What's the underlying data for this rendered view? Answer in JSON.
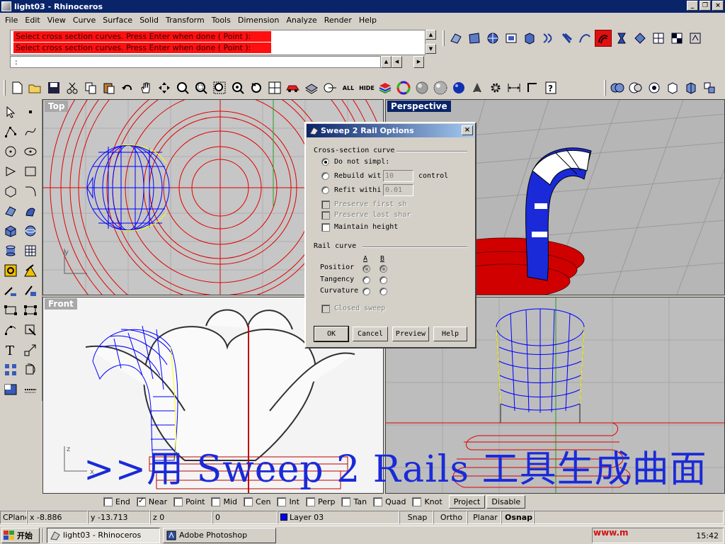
{
  "window": {
    "title": "light03 - Rhinoceros"
  },
  "menu": [
    "File",
    "Edit",
    "View",
    "Curve",
    "Surface",
    "Solid",
    "Transform",
    "Tools",
    "Dimension",
    "Analyze",
    "Render",
    "Help"
  ],
  "command": {
    "history": [
      "Select cross section curves. Press Enter when done ( Point ):",
      "Select cross section curves. Press Enter when done ( Point ):"
    ],
    "prompt": ":"
  },
  "toolbar": {
    "all_label": "ALL",
    "hide_label": "HIDE"
  },
  "viewports": {
    "top": "Top",
    "perspective": "Perspective",
    "front": "Front",
    "right_axis_z": "z",
    "top_axis": "y",
    "front_axis_z": "z",
    "front_axis_x": "x"
  },
  "dialog": {
    "title": "Sweep 2 Rail Options",
    "cross_section_group": "Cross-section curve",
    "do_not_simplify": "Do not simpl:",
    "rebuild_with": "Rebuild wit",
    "rebuild_value": "10",
    "control": "control",
    "refit_within": "Refit withi",
    "refit_value": "0.01",
    "preserve_first": "Preserve first sh",
    "preserve_last": "Preserve last shar",
    "maintain_height": "Maintain height",
    "rail_group": "Rail curve",
    "col_a": "A",
    "col_b": "B",
    "position": "Positior",
    "tangency": "Tangency",
    "curvature": "Curvature",
    "closed_sweep": "Closed sweep",
    "ok": "OK",
    "cancel": "Cancel",
    "preview": "Preview",
    "help": "Help"
  },
  "osnap": {
    "items": [
      {
        "label": "End",
        "checked": false
      },
      {
        "label": "Near",
        "checked": true
      },
      {
        "label": "Point",
        "checked": false
      },
      {
        "label": "Mid",
        "checked": false
      },
      {
        "label": "Cen",
        "checked": false
      },
      {
        "label": "Int",
        "checked": false
      },
      {
        "label": "Perp",
        "checked": false
      },
      {
        "label": "Tan",
        "checked": false
      },
      {
        "label": "Quad",
        "checked": false
      },
      {
        "label": "Knot",
        "checked": false
      }
    ],
    "project": "Project",
    "disable": "Disable"
  },
  "status": {
    "cplane": "CPlane",
    "x": "x -8.886",
    "y": "y -13.713",
    "z": "z 0",
    "extra": "0",
    "layer": "Layer 03",
    "snap": "Snap",
    "ortho": "Ortho",
    "planar": "Planar",
    "osnap": "Osnap"
  },
  "taskbar": {
    "start": "开始",
    "tasks": [
      "light03 - Rhinoceros",
      "Adobe Photoshop"
    ],
    "clock": "15:42"
  },
  "caption": ">>用 Sweep 2 Rails 工具生成曲面",
  "watermark": "www.m",
  "colors": {
    "accent": "#0a246a",
    "cmd_highlight": "#ff1010",
    "curve_red": "#e00000",
    "mesh_blue": "#0000ff"
  }
}
